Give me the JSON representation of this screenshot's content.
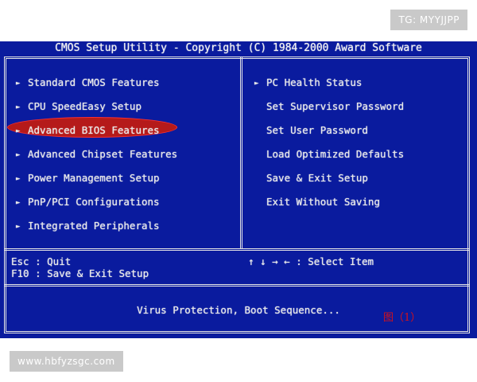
{
  "watermarks": {
    "top": "TG: MYYJJPP",
    "bottom": "www.hbfyzsgc.com"
  },
  "bios": {
    "title": "CMOS Setup Utility - Copyright (C) 1984-2000 Award Software",
    "left_menu": [
      "Standard CMOS Features",
      "CPU SpeedEasy Setup",
      "Advanced BIOS Features",
      "Advanced Chipset Features",
      "Power Management Setup",
      "PnP/PCI Configurations",
      "Integrated Peripherals"
    ],
    "right_menu": [
      "PC Health Status",
      "Set Supervisor Password",
      "Set User Password",
      "Load Optimized Defaults",
      "Save & Exit Setup",
      "Exit Without Saving"
    ],
    "selected_item": "Advanced BIOS Features",
    "help": {
      "esc": "Esc : Quit",
      "f10": "F10 : Save & Exit Setup",
      "nav": "↑ ↓ → ←   : Select Item"
    },
    "description": "Virus Protection, Boot Sequence...",
    "figure_label": "图（1）",
    "arrow_glyph": "►",
    "colors": {
      "background": "#0a1b9e",
      "text": "#e8e8e8",
      "highlight": "#b51a1a"
    }
  }
}
